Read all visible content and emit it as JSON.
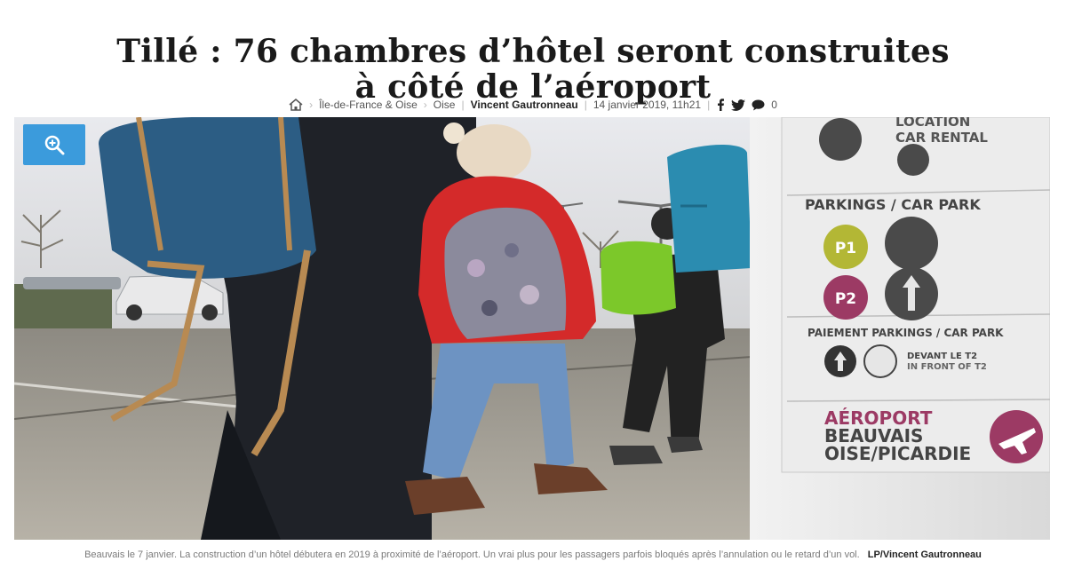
{
  "article": {
    "title_line1": "Tillé : 76 chambres d’hôtel seront construites",
    "title_line2": "à côté de l’aéroport"
  },
  "meta": {
    "home_icon": "home-icon",
    "sep_arrow": "›",
    "breadcrumb": [
      "Île-de-France & Oise",
      "Oise"
    ],
    "sep_bar": "|",
    "author": "Vincent Gautronneau",
    "date": "14 janvier 2019, 11h21",
    "social_icons": [
      "facebook-icon",
      "twitter-icon",
      "comment-icon"
    ],
    "comment_count": "0"
  },
  "photo": {
    "zoom_icon": "zoom-in-icon",
    "sign": {
      "location_label": "LOCATION",
      "car_rental": "CAR RENTAL",
      "parkings_title": "PARKINGS / CAR PARK",
      "p1": "P1",
      "p2": "P2",
      "paiement": "PAIEMENT PARKINGS / CAR PARK",
      "devant": "DEVANT LE T2",
      "in_front": "IN FRONT OF T2",
      "airport_1": "AÉROPORT",
      "airport_2": "BEAUVAIS",
      "airport_3": "OISE/PICARDIE"
    },
    "colors": {
      "accent_blue": "#3b9bdc",
      "p1_green": "#b3b735",
      "p2_magenta": "#9c3a64",
      "jacket_red": "#d42a2a",
      "backpack_green": "#7cc82a",
      "backpack_teal": "#2b8cb0"
    }
  },
  "caption": {
    "text": "Beauvais le 7 janvier. La construction d’un hôtel débutera en 2019 à proximité de l’aéroport. Un vrai plus pour les passagers parfois bloqués après l’annulation ou le retard d’un vol.",
    "credit": "LP/Vincent Gautronneau"
  }
}
